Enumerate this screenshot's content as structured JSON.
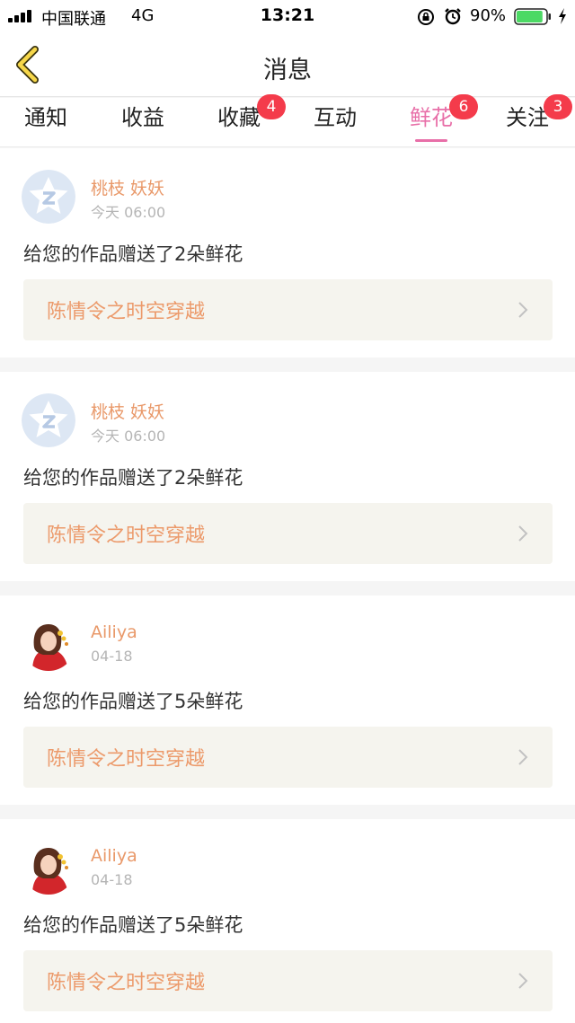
{
  "status_bar": {
    "carrier": "中国联通",
    "network": "4G",
    "time": "13:21",
    "battery_percent": "90%",
    "battery_level": 0.9,
    "battery_color": "#4cd964"
  },
  "nav": {
    "title": "消息"
  },
  "tabs": [
    {
      "label": "通知",
      "badge": ""
    },
    {
      "label": "收益",
      "badge": ""
    },
    {
      "label": "收藏",
      "badge": "4"
    },
    {
      "label": "互动",
      "badge": ""
    },
    {
      "label": "鲜花",
      "badge": "6"
    },
    {
      "label": "关注",
      "badge": "3"
    }
  ],
  "active_tab": "鲜花",
  "colors": {
    "accent_pink": "#e86fa8",
    "username_orange": "#e9996a",
    "badge_red": "#f43b4b",
    "link_bg": "#f5f4ee"
  },
  "feed": [
    {
      "user": "桃枝 妖妖",
      "time": "今天 06:00",
      "message": "给您的作品赠送了2朵鲜花",
      "work": "陈情令之时空穿越",
      "avatar": "default-qq-avatar"
    },
    {
      "user": "桃枝 妖妖",
      "time": "今天 06:00",
      "message": "给您的作品赠送了2朵鲜花",
      "work": "陈情令之时空穿越",
      "avatar": "default-qq-avatar"
    },
    {
      "user": "Ailiya",
      "time": "04-18",
      "message": "给您的作品赠送了5朵鲜花",
      "work": "陈情令之时空穿越",
      "avatar": "girl-photo-avatar"
    },
    {
      "user": "Ailiya",
      "time": "04-18",
      "message": "给您的作品赠送了5朵鲜花",
      "work": "陈情令之时空穿越",
      "avatar": "girl-photo-avatar"
    }
  ]
}
